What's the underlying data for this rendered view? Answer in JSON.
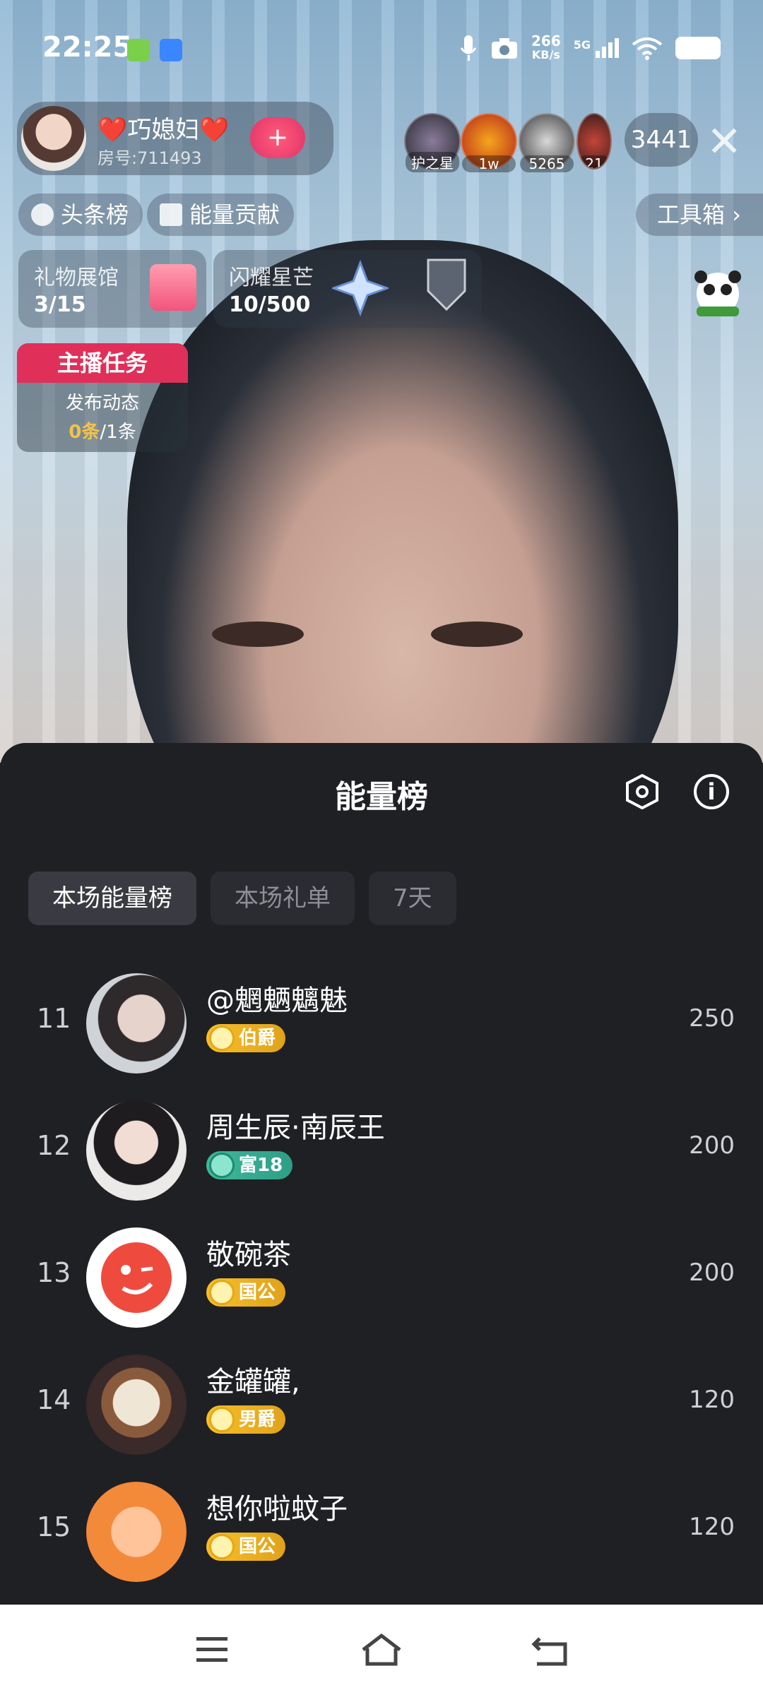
{
  "status_bar": {
    "time": "22:25",
    "net_speed_value": "266",
    "net_speed_unit": "KB/s",
    "network": "5G",
    "icons": [
      "notification-icon",
      "screen-cast-icon",
      "mic-icon",
      "camera-icon",
      "signal-icon",
      "wifi-icon",
      "battery-icon"
    ]
  },
  "host": {
    "name": "❤️巧媳妇❤️",
    "room": "房号:711493",
    "follow_label": "+"
  },
  "viewers": [
    {
      "label": "护之星"
    },
    {
      "label": "1w"
    },
    {
      "label": "5265"
    },
    {
      "label": "21"
    }
  ],
  "viewer_count": "3441",
  "chips": {
    "headlines": "头条榜",
    "energy_contribution": "能量贡献",
    "toolbox": "工具箱 ›"
  },
  "cards": {
    "gift_hall_title": "礼物展馆",
    "gift_hall_value": "3/15",
    "shine_title": "闪耀星芒",
    "shine_value": "10/500"
  },
  "task": {
    "title": "主播任务",
    "subtitle": "发布动态",
    "progress_done": "0条",
    "progress_total": "/1条"
  },
  "panel": {
    "title": "能量榜",
    "tabs": [
      "本场能量榜",
      "本场礼单",
      "7天"
    ],
    "rows": [
      {
        "rank": "11",
        "name": "@魍魉魑魅",
        "badge": "伯爵",
        "badge_color": "gold",
        "score": "250"
      },
      {
        "rank": "12",
        "name": "周生辰·南辰王",
        "badge": "富18",
        "badge_color": "teal",
        "score": "200"
      },
      {
        "rank": "13",
        "name": "敬碗茶",
        "badge": "国公",
        "badge_color": "gold",
        "score": "200"
      },
      {
        "rank": "14",
        "name": "金罐罐,",
        "badge": "男爵",
        "badge_color": "gold",
        "score": "120"
      },
      {
        "rank": "15",
        "name": "想你啦蚊子",
        "badge": "国公",
        "badge_color": "gold",
        "score": "120"
      }
    ]
  },
  "navbar": {
    "icons": [
      "menu-icon",
      "home-icon",
      "back-icon"
    ]
  }
}
